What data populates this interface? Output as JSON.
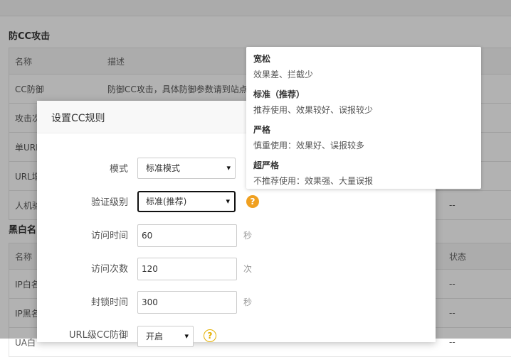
{
  "background": {
    "section_cc_title": "防CC攻击",
    "cc_table": {
      "headers": [
        "名称",
        "描述",
        ""
      ],
      "rows": [
        [
          "CC防御",
          "防御CC攻击，具体防御参数请到站点",
          ""
        ],
        [
          "攻击次",
          "",
          ""
        ],
        [
          "单URL",
          "",
          ""
        ],
        [
          "URL增",
          "",
          ""
        ],
        [
          "人机验",
          "",
          "--"
        ]
      ]
    },
    "section_bw_title": "黑白名",
    "bw_table": {
      "headers": [
        "名称",
        "",
        "状态"
      ],
      "rows": [
        [
          "IP白名",
          "",
          "--"
        ],
        [
          "IP黑名",
          "",
          "--"
        ],
        [
          "UA白",
          "",
          "--"
        ]
      ]
    }
  },
  "modal": {
    "title": "设置CC规则",
    "fields": {
      "mode": {
        "label": "模式",
        "value": "标准模式"
      },
      "level": {
        "label": "验证级别",
        "value": "标准(推荐)"
      },
      "visit_time": {
        "label": "访问时间",
        "value": "60",
        "unit": "秒"
      },
      "visit_count": {
        "label": "访问次数",
        "value": "120",
        "unit": "次"
      },
      "block_time": {
        "label": "封锁时间",
        "value": "300",
        "unit": "秒"
      },
      "url_cc": {
        "label": "URL级CC防御",
        "value": "开启"
      }
    }
  },
  "tooltip": {
    "items": [
      {
        "title": "宽松",
        "desc": "效果差、拦截少"
      },
      {
        "title": "标准（推荐）",
        "desc": "推荐使用、效果较好、误报较少"
      },
      {
        "title": "严格",
        "desc": "慎重使用：效果好、误报较多"
      },
      {
        "title": "超严格",
        "desc": "不推荐使用：效果强、大量误报"
      }
    ]
  },
  "icons": {
    "help": "?",
    "chevron": "▾"
  },
  "colors": {
    "help_orange": "#f0a020",
    "help_outline": "#e4b000",
    "overlay": "rgba(0,0,0,0.3)"
  }
}
